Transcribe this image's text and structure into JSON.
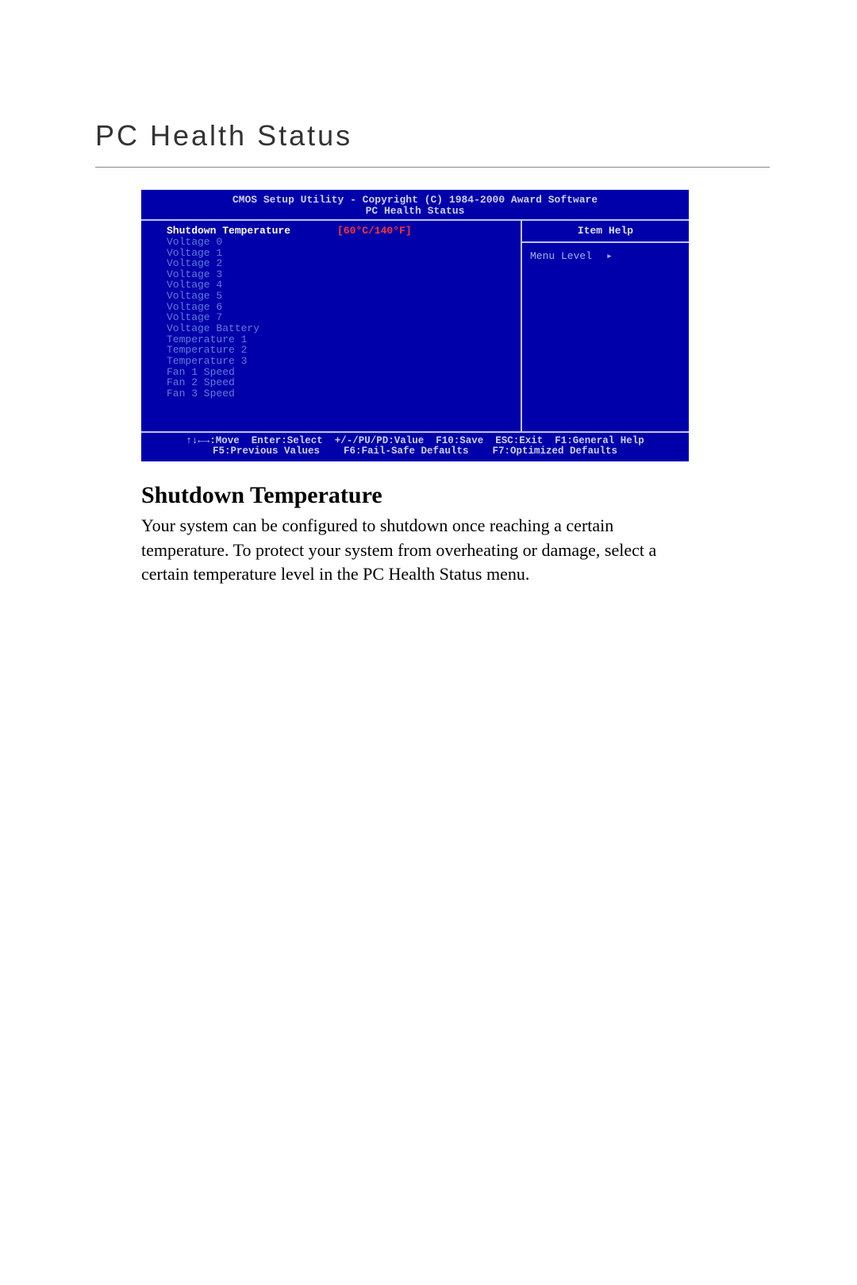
{
  "page": {
    "title": "PC Health Status"
  },
  "bios": {
    "header_line1": "CMOS Setup Utility - Copyright (C) 1984-2000 Award Software",
    "header_line2": "PC Health Status",
    "selected": {
      "label": "Shutdown Temperature",
      "value": "[60°C/140°F]"
    },
    "items": [
      "Voltage 0",
      "Voltage 1",
      "Voltage 2",
      "Voltage 3",
      "Voltage 4",
      "Voltage 5",
      "Voltage 6",
      "Voltage 7",
      "Voltage Battery",
      "Temperature 1",
      "Temperature 2",
      "Temperature 3",
      "Fan 1 Speed",
      "Fan 2 Speed",
      "Fan 3 Speed"
    ],
    "help_title": "Item Help",
    "menu_level_label": "Menu Level",
    "menu_level_arrow": "▸",
    "footer_line1": "↑↓←→:Move  Enter:Select  +/-/PU/PD:Value  F10:Save  ESC:Exit  F1:General Help",
    "footer_line2": "F5:Previous Values    F6:Fail-Safe Defaults    F7:Optimized Defaults"
  },
  "description": {
    "heading": "Shutdown Temperature",
    "body": "Your system can be configured to shutdown once reaching a certain temperature.  To protect your system from overheating or damage, select a certain temperature level in the PC Health Status menu."
  }
}
